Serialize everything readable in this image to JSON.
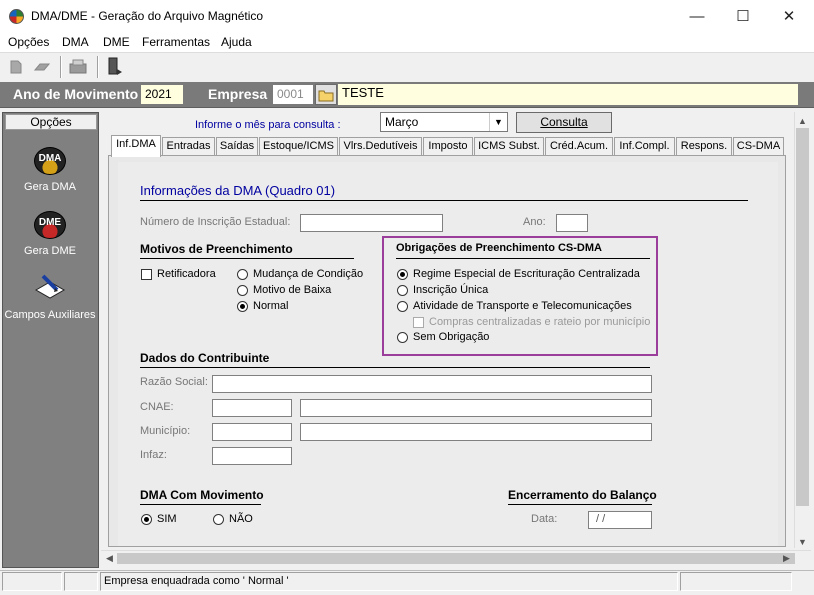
{
  "window": {
    "title": "DMA/DME - Geração do Arquivo Magnético",
    "minimize_glyph": "—",
    "maximize_glyph": "☐",
    "close_glyph": "✕"
  },
  "menu": [
    "Opções",
    "DMA",
    "DME",
    "Ferramentas",
    "Ajuda"
  ],
  "toolbar_icons": [
    "new-doc-icon",
    "open-icon",
    "print-icon",
    "exit-icon"
  ],
  "header": {
    "year_label": "Ano de Movimento",
    "year_value": "2021",
    "company_label": "Empresa",
    "company_code": "0001",
    "company_name": "TESTE"
  },
  "sidebar": {
    "title": "Opções",
    "items": [
      {
        "icon": "DMA",
        "label": "Gera DMA"
      },
      {
        "icon": "DME",
        "label": "Gera DME"
      },
      {
        "icon": "pen-paper-icon",
        "label": "Campos Auxiliares"
      }
    ]
  },
  "query": {
    "label": "Informe o mês para consulta :",
    "month": "Março",
    "button": "Consulta"
  },
  "tabs": [
    "Inf.DMA",
    "Entradas",
    "Saídas",
    "Estoque/ICMS",
    "Vlrs.Dedutíveis",
    "Imposto",
    "ICMS Subst.",
    "Créd.Acum.",
    "Inf.Compl.",
    "Respons.",
    "CS-DMA"
  ],
  "active_tab": "Inf.DMA",
  "form": {
    "section_title": "Informações da DMA (Quadro 01)",
    "ie_label": "Número de Inscrição Estadual:",
    "ie_value": "",
    "ano_label": "Ano:",
    "ano_value": "",
    "motivos_title": "Motivos de Preenchimento",
    "retificadora": "Retificadora",
    "motivos": [
      {
        "label": "Mudança de Condição",
        "selected": false
      },
      {
        "label": "Motivo de Baixa",
        "selected": false
      },
      {
        "label": "Normal",
        "selected": true
      }
    ],
    "cs_title": "Obrigações de Preenchimento CS-DMA",
    "cs_options": [
      {
        "label": "Regime Especial de Escrituração Centralizada",
        "selected": true
      },
      {
        "label": "Inscrição Única",
        "selected": false
      },
      {
        "label": "Atividade de Transporte e Telecomunicações",
        "selected": false
      }
    ],
    "cs_sub_check": "Compras centralizadas e rateio por município",
    "cs_none": "Sem Obrigação",
    "contrib_title": "Dados do Contribuinte",
    "razao_label": "Razão Social:",
    "cnae_label": "CNAE:",
    "municipio_label": "Município:",
    "infaz_label": "Infaz:",
    "movimento_title": "DMA Com Movimento",
    "sim": "SIM",
    "nao": "NÃO",
    "movimento_selected": "SIM",
    "encerramento_title": "Encerramento do Balanço",
    "data_label": "Data:",
    "data_value": " / /"
  },
  "status": {
    "message": "Empresa enquadrada como ' Normal '"
  }
}
